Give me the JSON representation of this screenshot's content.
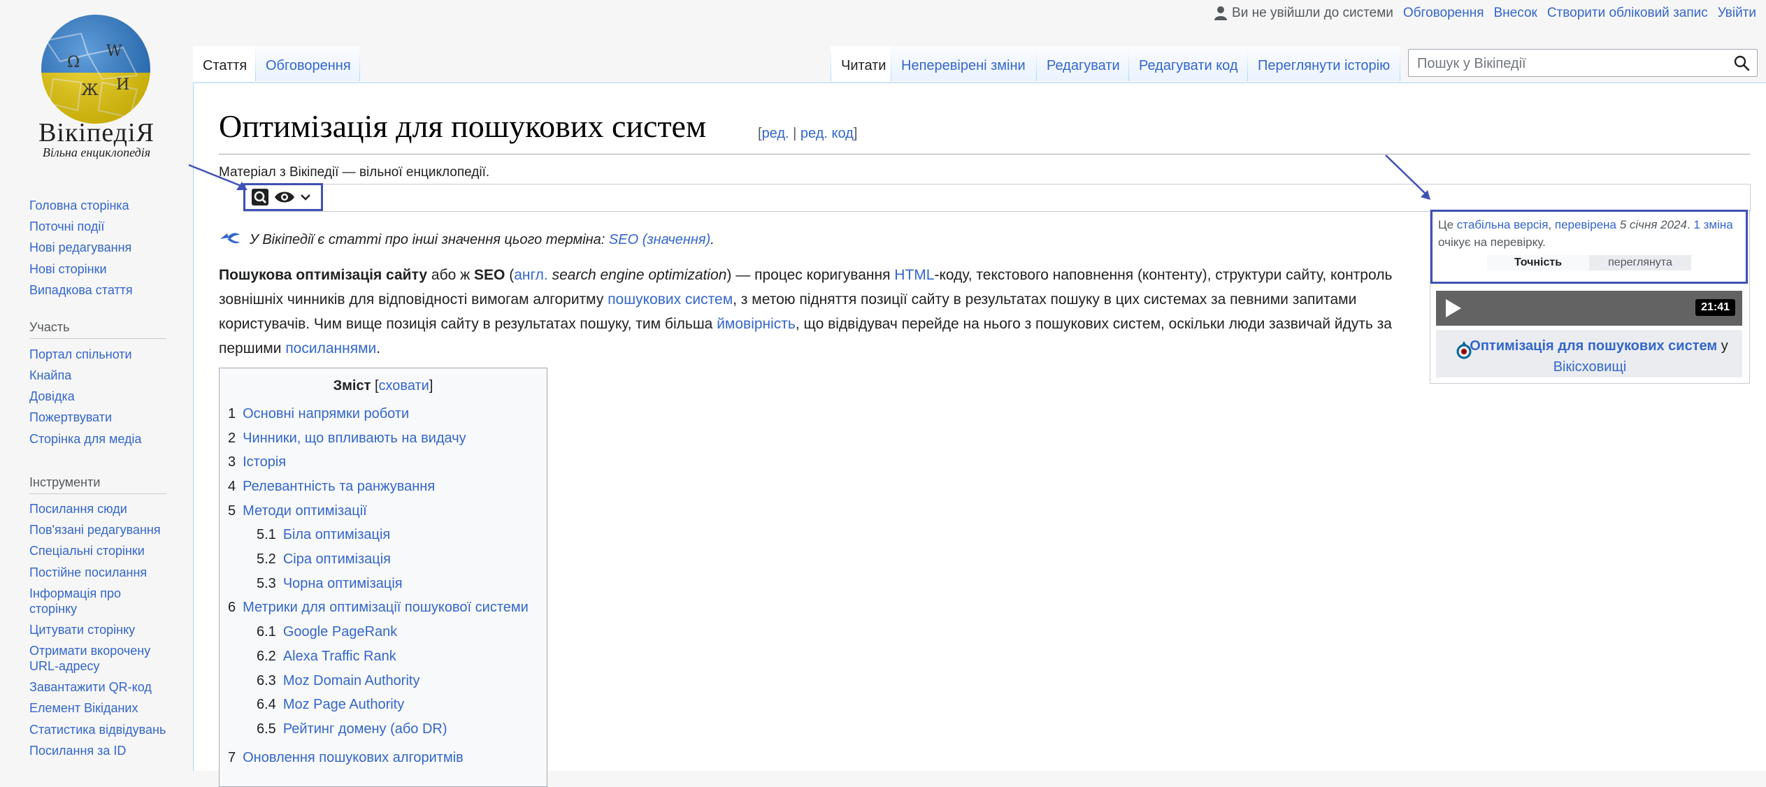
{
  "logo": {
    "wordmark": "ВікіпедіЯ",
    "tagline": "Вільна енциклопедія",
    "globe_glyphs": [
      "Ω",
      "W",
      "И",
      "Ж"
    ]
  },
  "sidebar": {
    "nav": [
      "Головна сторінка",
      "Поточні події",
      "Нові редагування",
      "Нові сторінки",
      "Випадкова стаття"
    ],
    "participation_heading": "Участь",
    "participation": [
      "Портал спільноти",
      "Кнайпа",
      "Довідка",
      "Пожертвувати",
      "Сторінка для медіа"
    ],
    "tools_heading": "Інструменти",
    "tools": [
      "Посилання сюди",
      "Пов'язані редагування",
      "Спеціальні сторінки",
      "Постійне посилання",
      "Інформація про",
      "сторінку",
      "Цитувати сторінку",
      "Отримати вкорочену",
      "URL-адресу",
      "Завантажити QR-код",
      "Елемент Вікіданих",
      "Статистика відвідувань",
      "Посилання за ID"
    ]
  },
  "personal": {
    "not_logged_in": "Ви не увійшли до системи",
    "links": [
      "Обговорення",
      "Внесок",
      "Створити обліковий запис",
      "Увійти"
    ]
  },
  "tabs": {
    "left": [
      "Стаття",
      "Обговорення"
    ],
    "right": [
      "Читати",
      "Неперевірені зміни",
      "Редагувати",
      "Редагувати код",
      "Переглянути історію"
    ]
  },
  "search": {
    "placeholder": "Пошук у Вікіпедії"
  },
  "article": {
    "title": "Оптимізація для пошукових систем",
    "edit_open": "[",
    "edit": "ред.",
    "edit_sep": " | ",
    "edit_code": "ред. код",
    "edit_close": "]",
    "from": "Матеріал з Вікіпедії — вільної енциклопедії.",
    "hatnote_text": "У Вікіпедії є статті про інші значення цього терміна: ",
    "hatnote_link": "SEO (значення)",
    "hatnote_end": ".",
    "intro": {
      "p1_bold": "Пошукова оптимізація сайту",
      "p2": " або ж ",
      "p3_bold": "SEO",
      "p4": " (",
      "p5_link": "англ.",
      "p6_italic": " search engine optimization",
      "p7": ") — процес коригування ",
      "p8_link": "HTML",
      "p9": "-коду, текстового наповнення (контенту), структури сайту, контроль зовнішніх чинників для відповідності вимогам алгоритму ",
      "p10_link": "пошукових систем",
      "p11": ", з метою підняття позиції сайту в результатах пошуку в цих системах за певними запитами користувачів. Чим вище позиція сайту в результатах пошуку, тим більша ",
      "p12_link": "ймовірність",
      "p13": ", що відвідувач перейде на нього з пошукових систем, оскільки люди зазвичай йдуть за першими ",
      "p14_link": "посиланнями",
      "p15": "."
    }
  },
  "toc": {
    "title": "Зміст",
    "hide_open": " [",
    "hide": "сховати",
    "hide_close": "]",
    "items": [
      {
        "num": "1",
        "label": "Основні напрямки роботи"
      },
      {
        "num": "2",
        "label": "Чинники, що впливають на видачу"
      },
      {
        "num": "3",
        "label": "Історія"
      },
      {
        "num": "4",
        "label": "Релевантність та ранжування"
      },
      {
        "num": "5",
        "label": "Методи оптимізації"
      },
      {
        "num": "5.1",
        "label": "Біла оптимізація"
      },
      {
        "num": "5.2",
        "label": "Сіра оптимізація"
      },
      {
        "num": "5.3",
        "label": "Чорна оптимізація"
      },
      {
        "num": "6",
        "label": "Метрики для оптимізації пошукової системи"
      },
      {
        "num": "6.1",
        "label": "Google PageRank"
      },
      {
        "num": "6.2",
        "label": "Alexa Traffic Rank"
      },
      {
        "num": "6.3",
        "label": "Moz Domain Authority"
      },
      {
        "num": "6.4",
        "label": "Moz Page Authority"
      },
      {
        "num": "6.5",
        "label": "Рейтинг домену (або DR)"
      },
      {
        "num": "7",
        "label": "Оновлення пошукових алгоритмів"
      }
    ]
  },
  "stable": {
    "pre": "Це ",
    "link1": "стабільна версія",
    "mid": ", ",
    "link2": "перевірена",
    "date": " 5 січня 2024",
    "dot": ". ",
    "link3": "1 зміна",
    "tail": " очікує на перевірку.",
    "tab_accuracy": "Точність",
    "tab_reviewed": "переглянута"
  },
  "media": {
    "duration": "21:41",
    "commons_link": "Оптимізація для пошукових систем",
    "commons_in": " у",
    "commons_site": "Вікісховищі"
  },
  "colors": {
    "link": "#3366cc",
    "highlight": "#3f51b5"
  }
}
